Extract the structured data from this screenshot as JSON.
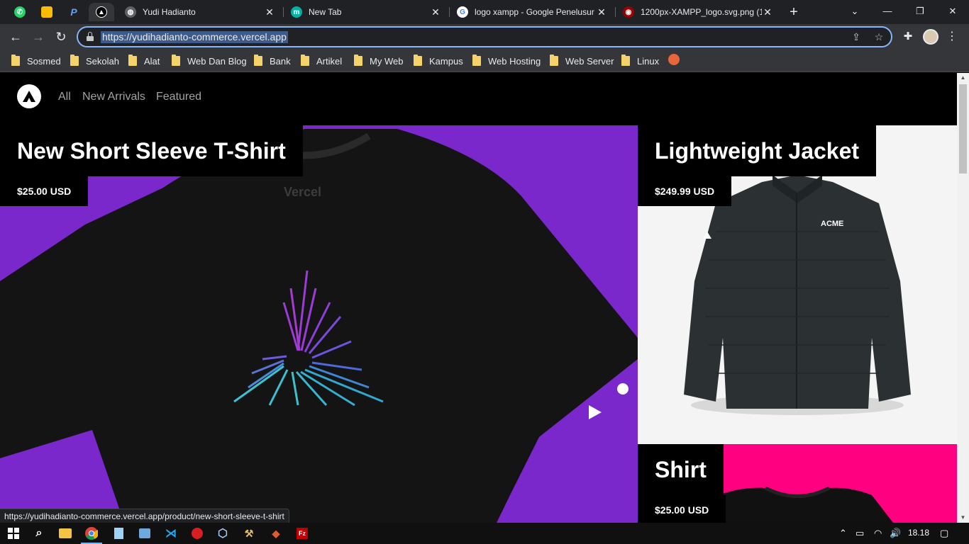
{
  "browser": {
    "pinned_tabs": [
      {
        "name": "whatsapp",
        "color": "#25d366"
      },
      {
        "name": "keep",
        "color": "#fbbc04"
      },
      {
        "name": "pp",
        "color": "#2f6fd6"
      },
      {
        "name": "acme-store",
        "color": "#000000"
      }
    ],
    "tabs": [
      {
        "title": "Yudi Hadianto",
        "icon": "globe-icon"
      },
      {
        "title": "New Tab",
        "icon": "m-icon"
      },
      {
        "title": "logo xampp - Google Penelusur",
        "icon": "google-icon"
      },
      {
        "title": "1200px-XAMPP_logo.svg.png (1",
        "icon": "wikimedia-icon"
      }
    ],
    "url": "https://yudihadianto-commerce.vercel.app",
    "bookmarks": [
      "Sosmed",
      "Sekolah",
      "Alat",
      "Web Dan Blog",
      "Bank",
      "Artikel",
      "My Web",
      "Kampus",
      "Web Hosting",
      "Web Server",
      "Linux"
    ],
    "status_url": "https://yudihadianto-commerce.vercel.app/product/new-short-sleeve-t-shirt"
  },
  "store": {
    "nav": [
      "All",
      "New Arrivals",
      "Featured"
    ],
    "products": [
      {
        "title": "New Short Sleeve T-Shirt",
        "price": "$25.00 USD",
        "bg": "#7a28cb",
        "print": "Vercel"
      },
      {
        "title": "Lightweight Jacket",
        "price": "$249.99 USD",
        "bg": "#f4f4f4",
        "print": "ACME"
      },
      {
        "title": "Shirt",
        "price": "$25.00 USD",
        "bg": "#ff0080"
      }
    ]
  },
  "taskbar": {
    "clock": "18.18"
  }
}
